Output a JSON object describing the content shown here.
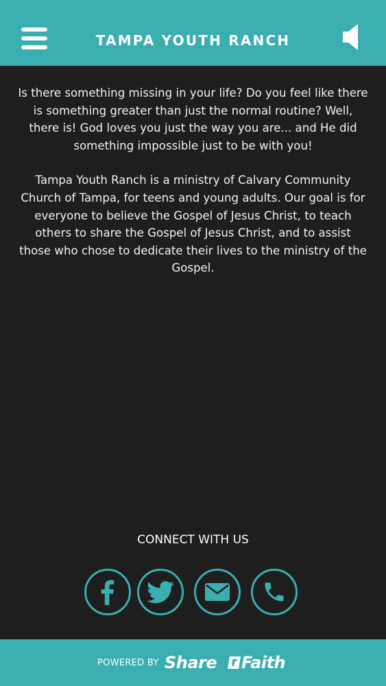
{
  "header": {
    "title": "TAMPA YOUTH RANCH",
    "menu_icon": "hamburger-menu-icon",
    "sound_icon": "speaker-icon"
  },
  "main": {
    "paragraphs": [
      "Is there something missing in your life? Do you feel like there is something greater than just the normal routine? Well, there is! God loves you just the way you are... and He did something impossible just to be with you!",
      "Tampa Youth Ranch is a ministry of Calvary Community Church of Tampa, for teens and young adults. Our goal is for everyone to believe the Gospel of Jesus Christ, to teach others to share the Gospel of Jesus Christ, and to assist those who chose to dedicate their lives to the ministry of the Gospel."
    ]
  },
  "connect": {
    "label": "CONNECT WITH US",
    "icons": [
      "facebook-icon",
      "twitter-icon",
      "email-icon",
      "phone-icon"
    ]
  },
  "footer": {
    "powered_by": "POWERED BY",
    "brand_part1": "Share",
    "brand_part2": "Faith"
  },
  "colors": {
    "accent": "#3aaeb0",
    "background": "#1e1e1e",
    "text": "#ffffff"
  }
}
